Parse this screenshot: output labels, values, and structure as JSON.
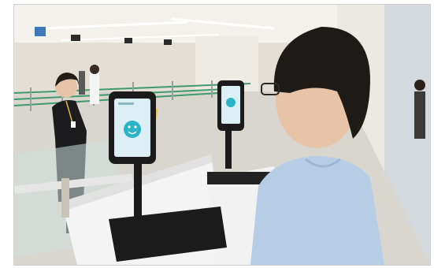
{
  "photo": {
    "subject": "biometric-face-recognition-gate",
    "palette": {
      "ceiling": "#f3f1ec",
      "floor": "#d9d6cf",
      "wall_panel": "#ece9e2",
      "gate_body": "#f4f4f4",
      "kiosk_black": "#1b1b1b",
      "screen_glow": "#dbeff5",
      "face_icon": "#2bb3c7",
      "shirt_blue": "#b7cde6",
      "hair_black": "#1e1a18",
      "skin": "#e7c4a7",
      "rope_green": "#3f9a6d",
      "officer_uniform": "#1c1c1e"
    }
  }
}
